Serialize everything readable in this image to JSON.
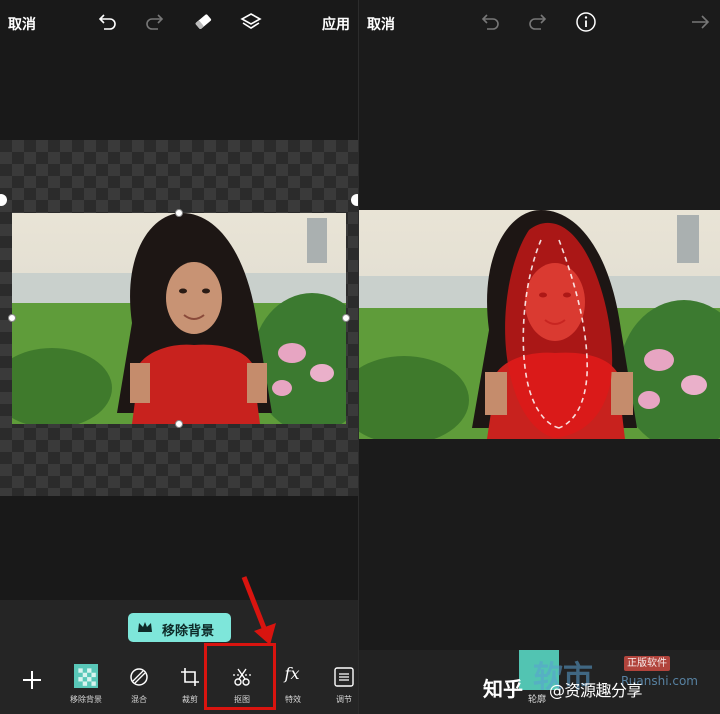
{
  "left": {
    "cancel_label": "取消",
    "apply_label": "应用",
    "icons": [
      "undo-icon",
      "redo-icon",
      "eraser-icon",
      "layers-icon"
    ],
    "remove_bg_label": "移除背景",
    "tools": [
      {
        "name": "remove-bg-tool",
        "label": "移除背景"
      },
      {
        "name": "blend-tool",
        "label": "混合"
      },
      {
        "name": "crop-tool",
        "label": "裁剪"
      },
      {
        "name": "cutout-tool",
        "label": "抠图"
      },
      {
        "name": "effects-tool",
        "label": "特效"
      },
      {
        "name": "adjust-tool",
        "label": "调节"
      }
    ],
    "effects_glyph": "fx"
  },
  "right": {
    "cancel_label": "取消",
    "icons": [
      "undo-icon",
      "redo-icon",
      "info-icon",
      "next-arrow-icon"
    ],
    "contour_label": "轮廓"
  },
  "watermark": {
    "zhihu": "知乎",
    "handle": "@资源趣分享",
    "big": "软市",
    "badge": "正版软件",
    "url": "Ruanshi.com"
  },
  "colors": {
    "accent_teal": "#7ee6da",
    "highlight_red": "#d9140f",
    "mask_red": "#e01818"
  }
}
